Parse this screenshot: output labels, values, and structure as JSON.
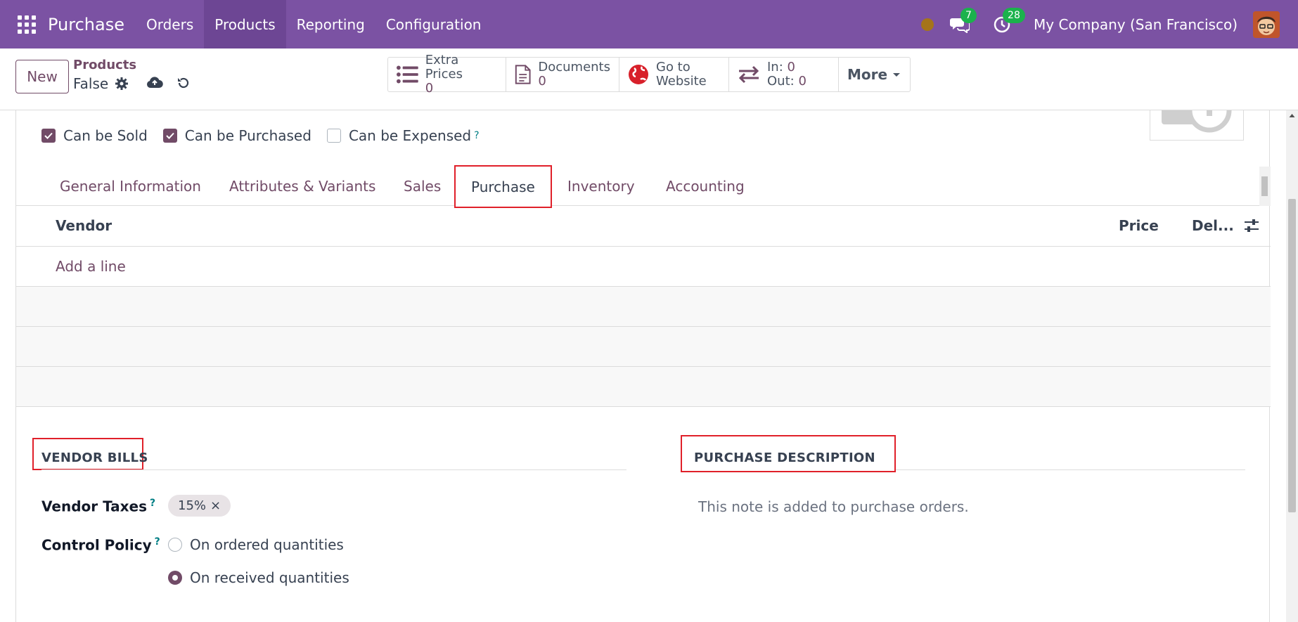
{
  "app": {
    "name": "Purchase",
    "menu": [
      "Orders",
      "Products",
      "Reporting",
      "Configuration"
    ],
    "active_menu": "Products",
    "messages_count": "7",
    "activities_count": "28",
    "company": "My Company (San Francisco)"
  },
  "control_panel": {
    "new_label": "New",
    "breadcrumb_parent": "Products",
    "breadcrumb_current": "False",
    "smart_buttons": {
      "extra_prices": {
        "label": "Extra Prices",
        "value": "0"
      },
      "documents": {
        "label": "Documents",
        "value": "0"
      },
      "website": {
        "line1": "Go to",
        "line2": "Website"
      },
      "moves": {
        "in_label": "In:",
        "in_value": "0",
        "out_label": "Out:",
        "out_value": "0"
      },
      "more": "More"
    }
  },
  "product": {
    "checkboxes": [
      {
        "label": "Can be Sold",
        "checked": true
      },
      {
        "label": "Can be Purchased",
        "checked": true
      },
      {
        "label": "Can be Expensed",
        "checked": false
      }
    ],
    "tabs": [
      "General Information",
      "Attributes & Variants",
      "Sales",
      "Purchase",
      "Inventory",
      "Accounting"
    ],
    "active_tab": "Purchase"
  },
  "vendor_table": {
    "columns": {
      "vendor": "Vendor",
      "price": "Price",
      "delivery": "Del..."
    },
    "add_line": "Add a line"
  },
  "vendor_bills": {
    "title": "VENDOR BILLS",
    "taxes_label": "Vendor Taxes",
    "tax_tag": "15%",
    "control_policy_label": "Control Policy",
    "policy_options": [
      "On ordered quantities",
      "On received quantities"
    ],
    "selected_policy": "On received quantities"
  },
  "purchase_description": {
    "title": "PURCHASE DESCRIPTION",
    "placeholder": "This note is added to purchase orders."
  },
  "colors": {
    "navbar": "#7b52a3",
    "accent": "#714b67",
    "highlight_box": "#e0202a",
    "badge": "#1bb24c"
  }
}
